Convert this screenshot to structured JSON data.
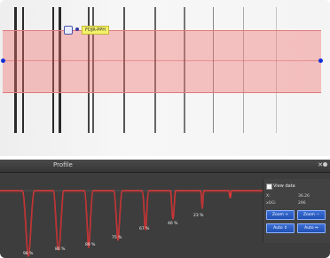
{
  "colors": {
    "roi_fill": "#f26e6e",
    "profile_line": "#e23a3a",
    "panel_bg": "#3d3d3d",
    "button_blue": "#2e5fc8",
    "annotation_yellow": "#f4f26a",
    "handle_blue": "#1430d8"
  },
  "image_view": {
    "annotation_label": "FDJR-PPH"
  },
  "profile_panel": {
    "title": "Profile",
    "percent_labels": [
      "98 %",
      "86 %",
      "89 %",
      "75 %",
      "67 %",
      "46 %",
      "23 %"
    ]
  },
  "side_panel": {
    "checkbox_label": "View data",
    "rows": [
      {
        "label": "X:",
        "value": "36.26"
      },
      {
        "label": "xOG:",
        "value": "296"
      }
    ],
    "buttons": {
      "zoom_in": "Zoom +",
      "zoom_out": "Zoom −",
      "auto_up": "Auto ⇕",
      "auto_right": "Auto ⇔"
    }
  },
  "icons": {
    "marker": "square-marker-icon",
    "close": "close-icon",
    "handle": "handle-icon"
  }
}
